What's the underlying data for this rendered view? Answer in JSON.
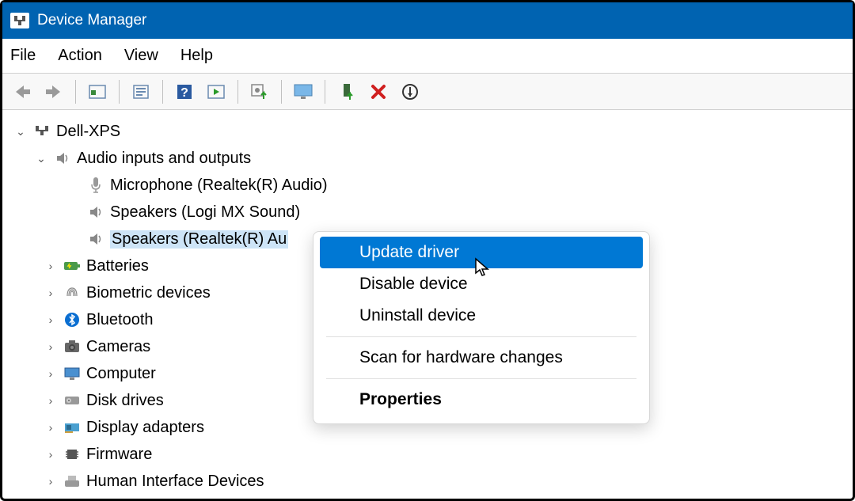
{
  "titlebar": {
    "title": "Device Manager"
  },
  "menubar": {
    "items": [
      "File",
      "Action",
      "View",
      "Help"
    ]
  },
  "tree": {
    "root": "Dell-XPS",
    "audio_category": "Audio inputs and outputs",
    "audio_children": [
      "Microphone (Realtek(R) Audio)",
      "Speakers (Logi MX Sound)",
      "Speakers (Realtek(R) Au"
    ],
    "collapsed": [
      "Batteries",
      "Biometric devices",
      "Bluetooth",
      "Cameras",
      "Computer",
      "Disk drives",
      "Display adapters",
      "Firmware",
      "Human Interface Devices"
    ]
  },
  "context_menu": {
    "items": [
      "Update driver",
      "Disable device",
      "Uninstall device",
      "Scan for hardware changes",
      "Properties"
    ]
  }
}
